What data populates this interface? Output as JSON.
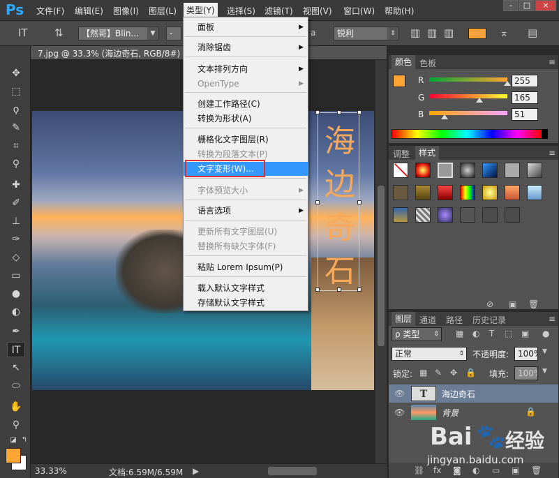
{
  "app": {
    "logo": "Ps"
  },
  "menubar": {
    "items": [
      "文件(F)",
      "编辑(E)",
      "图像(I)",
      "图层(L)",
      "类型(Y)",
      "选择(S)",
      "滤镜(T)",
      "视图(V)",
      "窗口(W)",
      "帮助(H)"
    ],
    "window_buttons": [
      "-",
      "□",
      "×"
    ]
  },
  "options": {
    "font_family": "【然哥】Blin...",
    "font_style": "-",
    "aa_label": "a",
    "antialias": "锐利",
    "text_color": "#f7a13a"
  },
  "document": {
    "tab_label": "7.jpg @ 33.3% (海边奇石, RGB/8#) *",
    "close": "×",
    "text_layer_chars": [
      "海",
      "边",
      "奇",
      "石"
    ]
  },
  "status": {
    "zoom": "33.33%",
    "doc_size": "文档:6.59M/6.59M"
  },
  "type_menu": {
    "items": [
      {
        "label": "面板",
        "sub": true,
        "disabled": false
      },
      {
        "label": "消除锯齿",
        "sub": true,
        "disabled": false
      },
      {
        "label": "文本排列方向",
        "sub": true,
        "disabled": false
      },
      {
        "label": "OpenType",
        "sub": true,
        "disabled": true
      },
      {
        "label": "创建工作路径(C)",
        "sub": false,
        "disabled": false
      },
      {
        "label": "转换为形状(A)",
        "sub": false,
        "disabled": false
      },
      {
        "label": "栅格化文字图层(R)",
        "sub": false,
        "disabled": false
      },
      {
        "label": "转换为段落文本(P)",
        "sub": false,
        "disabled": true
      },
      {
        "label": "文字变形(W)...",
        "sub": false,
        "disabled": false,
        "highlighted": true
      },
      {
        "label": "字体预览大小",
        "sub": true,
        "disabled": true
      },
      {
        "label": "语言选项",
        "sub": true,
        "disabled": false
      },
      {
        "label": "更新所有文字图层(U)",
        "sub": false,
        "disabled": true
      },
      {
        "label": "替换所有缺欠字体(F)",
        "sub": false,
        "disabled": true
      },
      {
        "label": "粘贴 Lorem Ipsum(P)",
        "sub": false,
        "disabled": false
      },
      {
        "label": "载入默认文字样式",
        "sub": false,
        "disabled": false
      },
      {
        "label": "存储默认文字样式",
        "sub": false,
        "disabled": false
      }
    ],
    "submenu_arrow": "▶"
  },
  "color_panel": {
    "tabs": [
      "颜色",
      "色板"
    ],
    "channels": [
      {
        "label": "R",
        "value": "255"
      },
      {
        "label": "G",
        "value": "165"
      },
      {
        "label": "B",
        "value": "51"
      }
    ],
    "foreground": "#ffa533"
  },
  "styles_panel": {
    "tabs": [
      "调整",
      "样式"
    ]
  },
  "layers_panel": {
    "tabs": [
      "图层",
      "通道",
      "路径",
      "历史记录"
    ],
    "filter": "ρ 类型",
    "blend_mode": "正常",
    "opacity_label": "不透明度:",
    "opacity": "100%",
    "lock_label": "锁定:",
    "fill_label": "填充:",
    "fill": "100%",
    "layers": [
      {
        "name": "海边奇石",
        "type_glyph": "T",
        "selected": true
      },
      {
        "name": "背景",
        "selected": false
      }
    ]
  },
  "watermark": {
    "brand": "Bai",
    "brand2": "经验",
    "url": "jingyan.baidu.com"
  }
}
